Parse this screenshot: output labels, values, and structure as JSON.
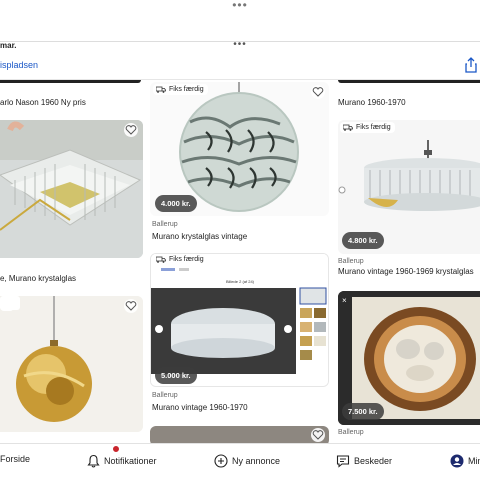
{
  "statusbar": {
    "date_fragment": "mar."
  },
  "header": {
    "back_label": "ispladsen"
  },
  "listings": {
    "a0": {
      "title": "arlo Nason 1960 Ny pris"
    },
    "a1": {
      "title": "e, Murano krystalglas"
    },
    "b0": {
      "tag": "Fiks færdig",
      "price": "4.000 kr.",
      "location": "Ballerup",
      "title": "Murano krystalglas vintage"
    },
    "b1": {
      "tag": "Fiks færdig",
      "price": "5.000 kr.",
      "location": "Ballerup",
      "title": "Murano vintage 1960-1970",
      "screenshot_heading": "Billede 2 (af 24)"
    },
    "c0": {
      "title": "Murano 1960-1970"
    },
    "c1": {
      "tag": "Fiks færdig",
      "price": "4.800 kr.",
      "location": "Ballerup",
      "title": "Murano vintage 1960-1969 krystalglas"
    },
    "c2": {
      "price": "7.500 kr.",
      "location": "Ballerup"
    }
  },
  "nav": {
    "home": "Forside",
    "notifications": "Notifikationer",
    "new_ad": "Ny annonce",
    "messages": "Beskeder",
    "mine": "Min"
  },
  "colors": {
    "accent": "#1a57c7",
    "badge": "#c9252c",
    "tag_bg": "#ffffff"
  }
}
